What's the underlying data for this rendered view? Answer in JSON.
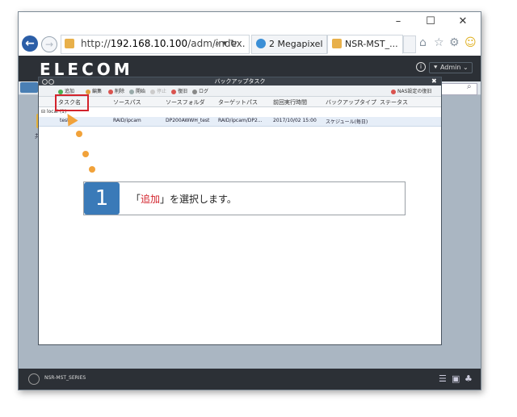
{
  "window": {
    "minimize": "–",
    "maximize": "☐",
    "close": "✕"
  },
  "browser": {
    "url_prefix": "http://",
    "url_host": "192.168.10.100",
    "url_path": "/adm/index.",
    "url_tools": "⌕ ▾ ↻",
    "tabs": [
      {
        "label": "2 Megapixel ...",
        "close": ""
      },
      {
        "label": "NSR-MST_...",
        "close": "×"
      }
    ],
    "toolbar_icons": [
      "home-icon",
      "star-icon",
      "gear-icon",
      "smiley-icon"
    ]
  },
  "app": {
    "logo": "ELECOM",
    "info": "i",
    "admin": "⯆ Admin ⌄"
  },
  "desktop": {
    "folder_label": "共有"
  },
  "dialog": {
    "title": "バックアップタスク",
    "close": "✖",
    "toolbar": {
      "add": "追加",
      "edit": "編集",
      "delete": "削除",
      "start": "開始",
      "stop": "停止",
      "restore": "復旧",
      "log": "ログ",
      "nas_restore": "NAS設定の復旧"
    },
    "columns": [
      "タスク名",
      "ソースパス",
      "ソースフォルダ",
      "ターゲットパス",
      "前回実行時間",
      "バックアップタイプ",
      "ステータス"
    ],
    "group": "local (1)",
    "rows": [
      {
        "task": "test",
        "source_path": "RAID/ipcam",
        "source_folder": "DP200AWWH_test",
        "target_path": "RAID/ipcam/DP2...",
        "last_run": "2017/10/02 15:00",
        "type": "スケジュール(毎日)",
        "status": ""
      }
    ]
  },
  "callout": {
    "step": "1",
    "open": "「",
    "highlight": "追加",
    "rest": "」を選択します。"
  },
  "footer": {
    "label": "NSR-MST_SERIES"
  },
  "colors": {
    "accent": "#3a7ab8",
    "highlight": "#d3232c",
    "dot": "#f1a23a",
    "header": "#2c3036"
  }
}
